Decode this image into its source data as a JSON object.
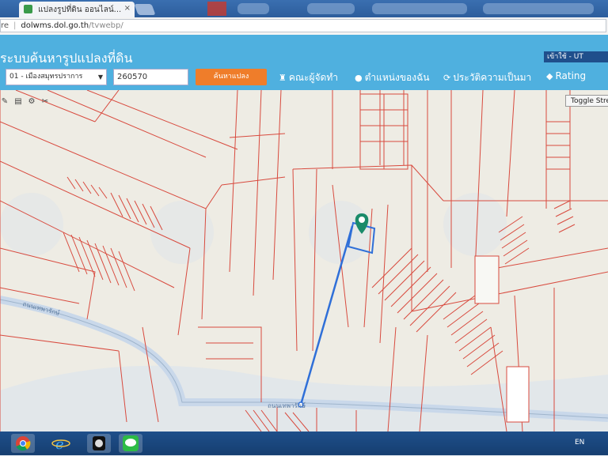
{
  "browser": {
    "tab_title": "แปลงรูปที่ดิน ออนไลน์...",
    "tab_close": "×",
    "address_prefix": "re",
    "url_host": "dolwms.dol.go.th",
    "url_path": "/tvwebp/"
  },
  "header": {
    "title": "ระบบค้นหารูปแปลงที่ดิน",
    "province_value": "01 - เมืองสมุทรปราการ",
    "parcel_value": "260570",
    "search_label": "ค้นหาแปลง",
    "nav": [
      {
        "icon": "trophy-icon",
        "glyph": "♜",
        "label": "คณะผู้จัดทำ"
      },
      {
        "icon": "person-icon",
        "glyph": "●",
        "label": "ตำแหน่งของฉัน"
      },
      {
        "icon": "history-icon",
        "glyph": "⟳",
        "label": "ประวัติความเป็นมา"
      },
      {
        "icon": "tag-icon",
        "glyph": "◆",
        "label": "Rating"
      }
    ],
    "user_label": "เข้าใช้ - UT"
  },
  "map": {
    "toggle_label": "Toggle Street",
    "road_label_1": "ถนนเทพารักษ์",
    "road_label_2": "ถนนเทพารักษ์",
    "tools": [
      "✎",
      "▤",
      "⚙",
      "✂"
    ]
  },
  "taskbar": {
    "apps": [
      "chrome-icon",
      "ie-icon",
      "app-icon",
      "line-icon"
    ],
    "tray_lang": "EN"
  },
  "colors": {
    "header_bg": "#4fb0df",
    "search_button": "#ef7d2a",
    "parcel_lines": "#d84a3e",
    "route": "#2f6fd8",
    "map_bg": "#eeece4",
    "marker": "#1a8b6a"
  }
}
